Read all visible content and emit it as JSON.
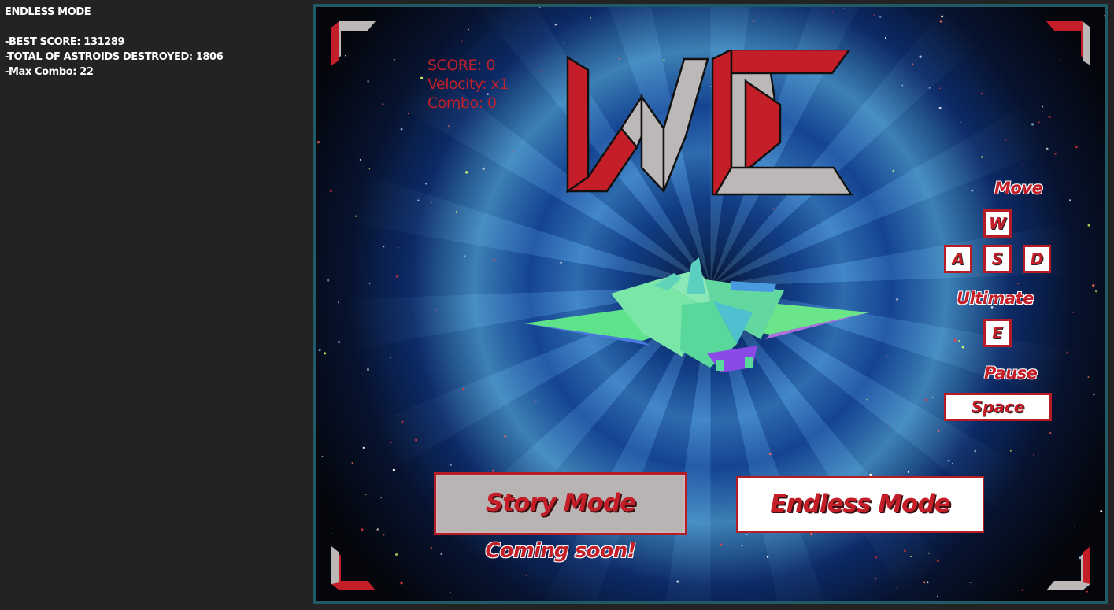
{
  "stats_panel": {
    "title": "ENDLESS MODE",
    "best_score": "-BEST SCORE: 131289",
    "asteroids_destroyed": "-TOTAL OF ASTROIDS DESTROYED: 1806",
    "max_combo": "-Max Combo: 22"
  },
  "hud": {
    "score": "SCORE: 0",
    "velocity": "Velocity: x1",
    "combo": "Combo: 0"
  },
  "logo": {
    "text": "WE"
  },
  "controls": {
    "move_label": "Move",
    "keys": {
      "up": "W",
      "left": "A",
      "down": "S",
      "right": "D"
    },
    "ultimate_label": "Ultimate",
    "ultimate_key": "E",
    "pause_label": "Pause",
    "pause_key": "Space"
  },
  "menu": {
    "story_mode_label": "Story Mode",
    "story_mode_note": "Coming soon!",
    "endless_mode_label": "Endless Mode"
  },
  "colors": {
    "accent_red": "#c41f29",
    "frame_border": "#1f5a66",
    "panel_bg": "#232323",
    "logo_gray": "#bcb8b8"
  },
  "icons": [
    "corner-bracket-icon",
    "spaceship-icon",
    "logo-icon"
  ]
}
